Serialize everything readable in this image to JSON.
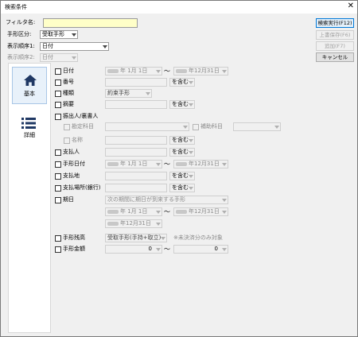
{
  "window": {
    "title": "検索条件",
    "close_icon": "close-icon"
  },
  "top": {
    "filter_label": "フィルタ名:",
    "filter_value": "",
    "kubun_label": "手形区分:",
    "kubun_value": "受取手形",
    "order1_label": "表示順序1:",
    "order1_value": "日付",
    "order2_label": "表示順序2:",
    "order2_value": "日付"
  },
  "buttons": {
    "search": "検索実行(F12)",
    "overwrite": "上書保存(F6)",
    "add": "追加(F7)",
    "cancel": "キャンセル"
  },
  "tabs": [
    {
      "label": "基本",
      "icon": "home-icon"
    },
    {
      "label": "詳細",
      "icon": "list-icon"
    }
  ],
  "fields": {
    "date": {
      "label": "日付",
      "from_suffix": "年 1月 1日",
      "to_suffix": "年12月31日"
    },
    "number": {
      "label": "番号",
      "match": "を含む"
    },
    "kind": {
      "label": "種類",
      "value": "約束手形"
    },
    "summary": {
      "label": "摘要",
      "match": "を含む"
    },
    "drawer": {
      "label": "振出人/裏書人",
      "account_label": "勘定科目",
      "sub_account_label": "補助科目",
      "name_label": "名称",
      "match": "を含む"
    },
    "payer": {
      "label": "支払人",
      "match": "を含む"
    },
    "note_date": {
      "label": "手形日付",
      "from_suffix": "年 1月 1日",
      "to_suffix": "年12月31日"
    },
    "pay_place": {
      "label": "支払地",
      "match": "を含む"
    },
    "pay_bank": {
      "label": "支払場所(銀行)",
      "match": "を含む"
    },
    "due": {
      "label": "期日",
      "mode": "次の期間に期日が到来する手形",
      "from_suffix": "年 1月 1日",
      "to_suffix": "年12月31日",
      "extra_suffix": "年12月31日"
    },
    "balance": {
      "label": "手形残高",
      "value": "受取手形(手持+取立)",
      "note": "※未決済分のみ対象"
    },
    "amount": {
      "label": "手形金額",
      "from": "0",
      "to": "0"
    }
  },
  "tilde": "〜"
}
